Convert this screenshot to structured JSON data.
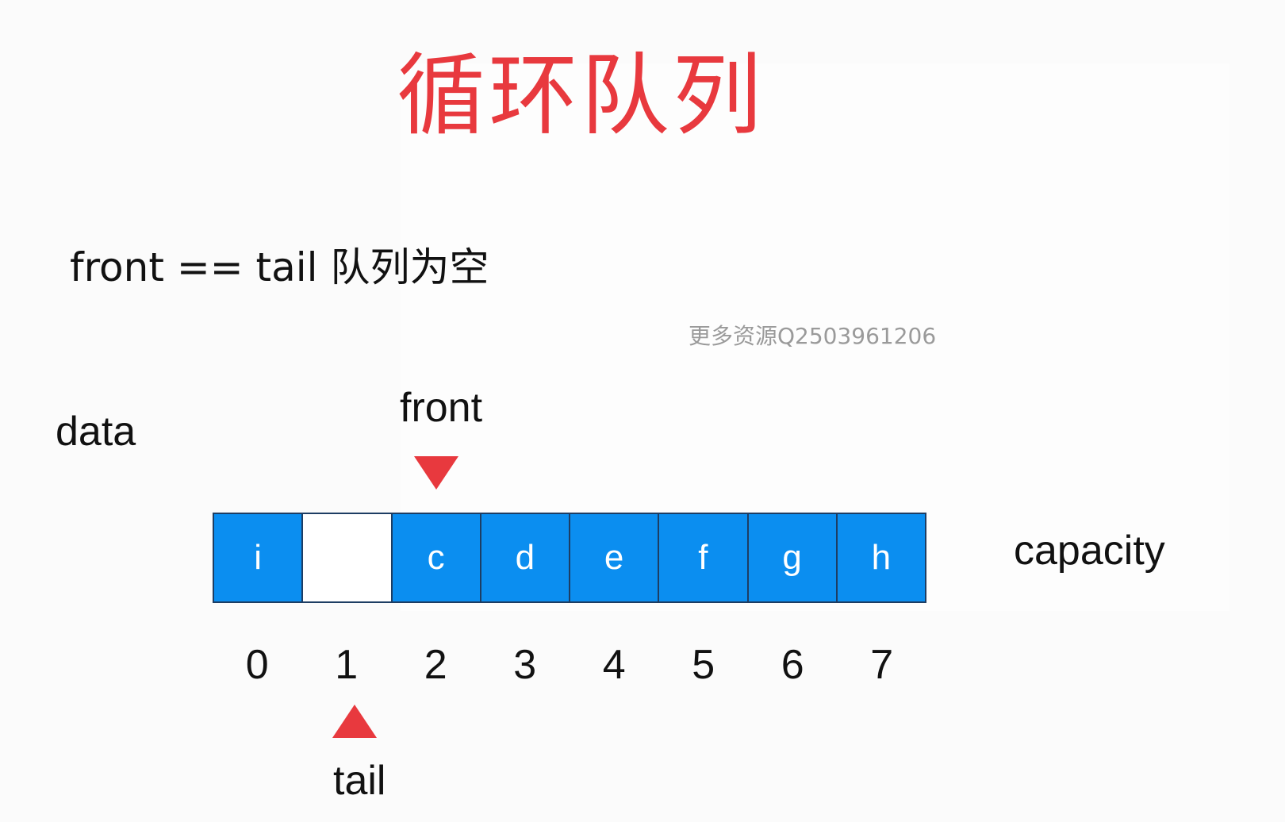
{
  "title": "循环队列",
  "rule_text": "front == tail 队列为空",
  "watermark": "更多资源Q2503961206",
  "labels": {
    "data": "data",
    "front": "front",
    "capacity": "capacity",
    "tail": "tail"
  },
  "array": {
    "cells": [
      "i",
      "",
      "c",
      "d",
      "e",
      "f",
      "g",
      "h"
    ],
    "indices": [
      "0",
      "1",
      "2",
      "3",
      "4",
      "5",
      "6",
      "7"
    ],
    "front_index": 2,
    "tail_index": 1
  },
  "colors": {
    "title": "#e8393e",
    "cell_fill": "#0b8ef0",
    "empty_cell_fill": "#ffffff",
    "pointer": "#e8393e",
    "cell_border": "#1d3d63"
  },
  "icons": {
    "front_pointer": "triangle-down-icon",
    "tail_pointer": "triangle-up-icon"
  }
}
